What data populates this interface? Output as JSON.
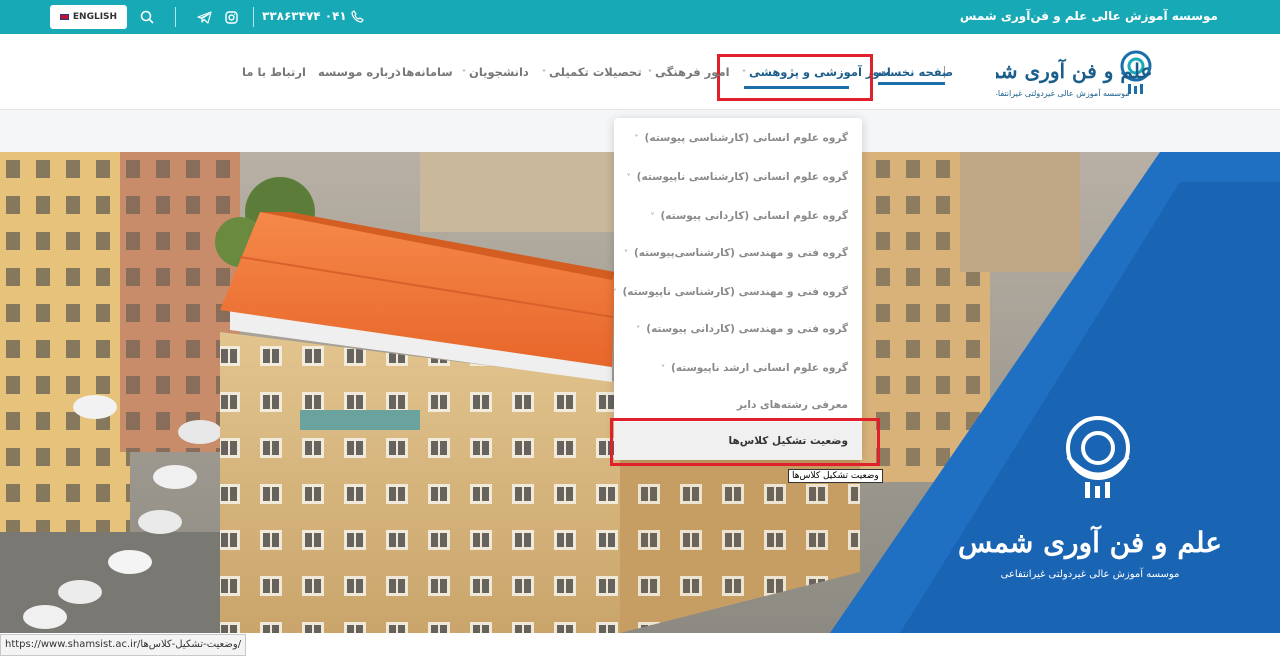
{
  "topbar": {
    "title": "موسسه آموزش عالی علم و فن‌آوری شمس",
    "language_button": "ENGLISH",
    "phone": "۰۴۱ ۳۳۸۶۳۴۷۴"
  },
  "logo": {
    "name": "علم و فن آوری شمس",
    "subtitle": "موسسه آموزش عالی غیردولتی غیرانتفاعی"
  },
  "nav": {
    "home": "صفحه نخست",
    "education": "امور آموزشی و پژوهشی",
    "cultural": "امور فرهنگی",
    "graduate": "تحصیلات تکمیلی",
    "students": "دانشجویان",
    "systems": "سامانه‌ها",
    "about": "درباره موسسه",
    "contact": "ارتباط با ما"
  },
  "dropdown": {
    "items": [
      "گروه علوم انسانی (کارشناسی پیوسته)",
      "گروه علوم انسانی (کارشناسی ناپیوسته)",
      "گروه علوم انسانی (کاردانی پیوسته)",
      "گروه فنی و مهندسی (کارشناسی‌پیوسته)",
      "گروه فنی و مهندسی (کارشناسی ناپیوسته)",
      "گروه فنی و مهندسی (کاردانی پیوسته)",
      "گروه علوم انسانی ارشد ناپیوسته)",
      "معرفی رشته‌های دایر",
      "وضعیت تشکیل کلاس‌ها"
    ]
  },
  "tooltip": "وضعیت تشکیل کلاس‌ها",
  "statusbar": "https://www.shamsist.ac.ir/وضعیت-تشکیل-کلاس‌ها/",
  "colors": {
    "topbar": "#17a9b5",
    "accent_blue": "#1b6fa8",
    "highlight_red": "#e0202a"
  }
}
